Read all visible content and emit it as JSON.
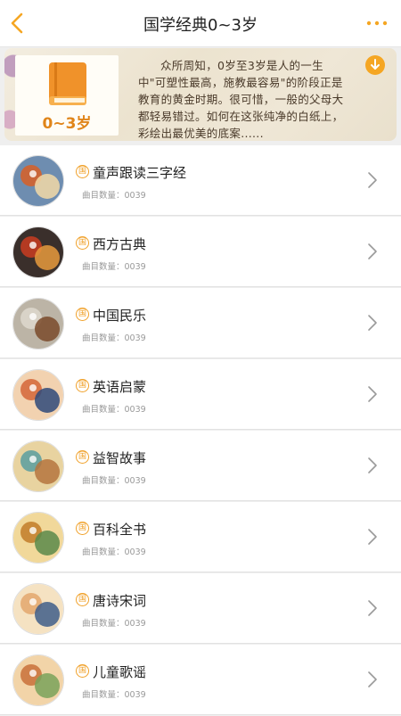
{
  "header": {
    "title": "国学经典0~3岁"
  },
  "banner": {
    "age_label": "0~3岁",
    "description": "众所周知，0岁至3岁是人的一生中\"可塑性最高，施教最容易\"的阶段正是教育的黄金时期。很可惜，一般的父母大都轻易错过。如何在这张纯净的白纸上，彩绘出最优美的底案......"
  },
  "badge_char": "国",
  "meta_label": "曲目数量：0039",
  "items": [
    {
      "title": "童声跟读三字经",
      "meta": "曲目数量：0039",
      "colors": [
        "#c9663a",
        "#f3d9a7",
        "#6e8db0"
      ]
    },
    {
      "title": "西方古典",
      "meta": "曲目数量：0039",
      "colors": [
        "#b43a22",
        "#e79a3d",
        "#3a2f2b"
      ]
    },
    {
      "title": "中国民乐",
      "meta": "曲目数量：0039",
      "colors": [
        "#d9d3c8",
        "#7a4a2a",
        "#bcb4a6"
      ]
    },
    {
      "title": "英语启蒙",
      "meta": "曲目数量：0039",
      "colors": [
        "#d9764a",
        "#2f4a7a",
        "#f2d2b0"
      ]
    },
    {
      "title": "益智故事",
      "meta": "曲目数量：0039",
      "colors": [
        "#6fa6a0",
        "#b5743e",
        "#e8d3a0"
      ]
    },
    {
      "title": "百科全书",
      "meta": "曲目数量：0039",
      "colors": [
        "#c98a3a",
        "#5a8a4a",
        "#f1d89a"
      ]
    },
    {
      "title": "唐诗宋词",
      "meta": "曲目数量：0039",
      "colors": [
        "#e6b07a",
        "#3f5e8a",
        "#f5e2c2"
      ]
    },
    {
      "title": "儿童歌谣",
      "meta": "曲目数量：0039",
      "colors": [
        "#cf7f4a",
        "#7aa25a",
        "#f2d4a8"
      ]
    }
  ],
  "colors": {
    "accent": "#f5a623",
    "text": "#222222",
    "meta": "#999999"
  }
}
